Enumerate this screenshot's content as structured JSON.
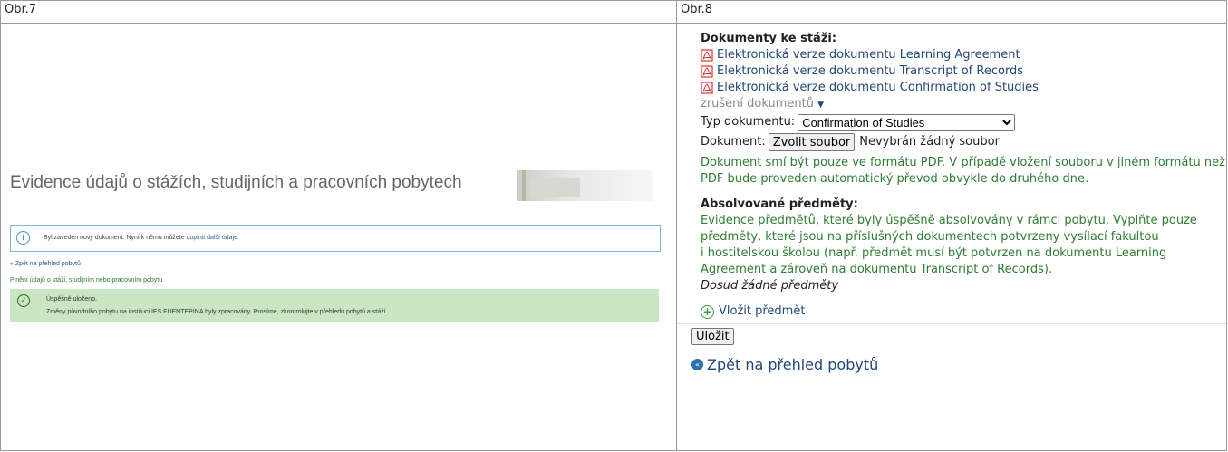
{
  "headers": {
    "left": "Obr.7",
    "right": "Obr.8"
  },
  "left": {
    "title": "Evidence údajů o stážích, studijních a pracovních pobytech",
    "info_text": "Byl zaveden nový dokument. Nyní k němu můžete",
    "info_link": "doplnit další údaje.",
    "back_link": "Zpět na přehled pobytů",
    "subtitle": "Plnění údajů o stáži, studijním nebo pracovním pobytu",
    "success_title": "Úspěšně uloženo.",
    "success_text": "Změny původního pobytu na instituci IES FUENTEPINA byly zpracovány. Prosíme, zkontrolujte v přehledu pobytů a stáží."
  },
  "right": {
    "documents_title": "Dokumenty ke stáži:",
    "documents": [
      "Elektronická verze dokumentu Learning Agreement",
      "Elektronická verze dokumentu Transcript of Records",
      "Elektronická verze dokumentu Confirmation of Studies"
    ],
    "cancel_label": "zrušení dokumentů",
    "type_label": "Typ dokumentu:",
    "type_selected": "Confirmation of Studies",
    "doc_label": "Dokument:",
    "choose_file": "Zvolit soubor",
    "no_file": "Nevybrán žádný soubor",
    "pdf_note_1": "Dokument smí být pouze ve formátu PDF. V případě vložení souboru v jiném formátu než",
    "pdf_note_2": "PDF bude proveden automatický převod obvykle do druhého dne.",
    "subjects_title": "Absolvované předměty:",
    "subjects_note_1": "Evidence předmětů, které byly úspěšně absolvovány v rámci pobytu. Vyplňte pouze",
    "subjects_note_2": "předměty, které jsou na příslušných dokumentech potvrzeny vysílací fakultou",
    "subjects_note_3": "i hostitelskou školou (např. předmět musí být potvrzen na dokumentu Learning",
    "subjects_note_4": "Agreement a zároveň na dokumentu Transcript of Records).",
    "no_subjects": "Dosud žádné předměty",
    "add_subject": "Vložit předmět",
    "save": "Uložit",
    "back": "Zpět na přehled pobytů"
  },
  "colors": {
    "link": "#23477a",
    "green_text": "#2e7d32",
    "success_bg": "#cbe6c2",
    "info_border": "#7fb6d6"
  },
  "icons": [
    "pdf-icon",
    "info-icon",
    "check-icon",
    "plus-circle-icon",
    "back-circle-icon",
    "chevron-down-icon"
  ]
}
